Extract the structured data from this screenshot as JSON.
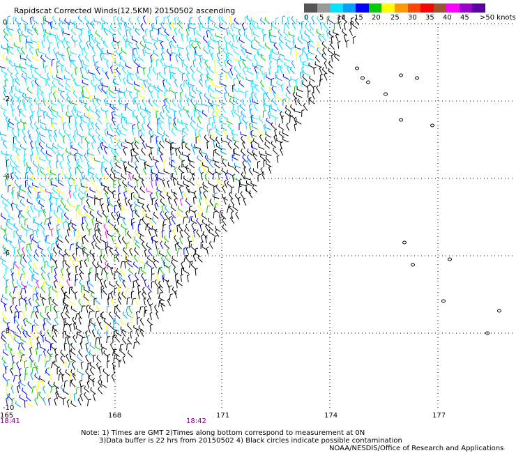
{
  "title": "Rapidscat Corrected Winds(12.5KM) 20150502 ascending",
  "legend": {
    "labels": [
      "0",
      "5",
      "10",
      "15",
      "20",
      "25",
      "30",
      "35",
      "40",
      "45",
      ">50 knots"
    ],
    "colors": [
      "#555555",
      "#999999",
      "#00e5ff",
      "#00a0ff",
      "#0000ff",
      "#00cc00",
      "#ffff00",
      "#ff9900",
      "#ff4400",
      "#ff0000",
      "#a0522d",
      "#ff00ff",
      "#9900cc",
      "#5a00a0"
    ]
  },
  "axes": {
    "x_ticks": [
      "165",
      "168",
      "171",
      "174",
      "177"
    ],
    "y_ticks": [
      "0",
      "-2",
      "-4",
      "-6",
      "-8",
      "-10"
    ]
  },
  "times": [
    "18:41",
    "18:42"
  ],
  "notes": [
    "Note: 1) Times are GMT 2)Times along bottom correspond to measurement at 0N",
    "3)Data buffer is 22 hrs from 20150502 4) Black circles indicate possible contamination"
  ],
  "credit": "NOAA/NESDIS/Office of Research and Applications",
  "wind_colors": {
    "black": "#000000",
    "cyan": "#00e5ff",
    "lightblue": "#00a0ff",
    "blue": "#0000ff",
    "green": "#00cc00",
    "yellow": "#ffff00",
    "magenta": "#ff00ff"
  }
}
